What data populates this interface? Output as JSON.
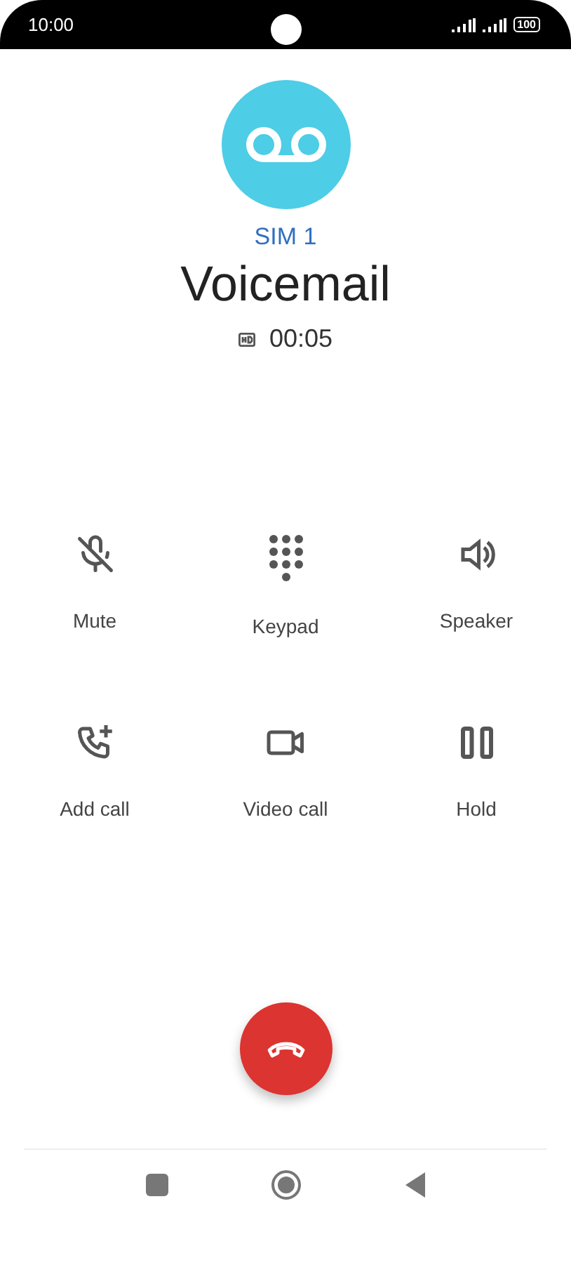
{
  "status_bar": {
    "time": "10:00",
    "battery": "100"
  },
  "call": {
    "sim": "SIM 1",
    "name": "Voicemail",
    "duration": "00:05"
  },
  "controls": [
    {
      "kind": "mute",
      "label": "Mute"
    },
    {
      "kind": "keypad",
      "label": "Keypad"
    },
    {
      "kind": "speaker",
      "label": "Speaker"
    },
    {
      "kind": "add",
      "label": "Add call"
    },
    {
      "kind": "video",
      "label": "Video call"
    },
    {
      "kind": "hold",
      "label": "Hold"
    }
  ]
}
